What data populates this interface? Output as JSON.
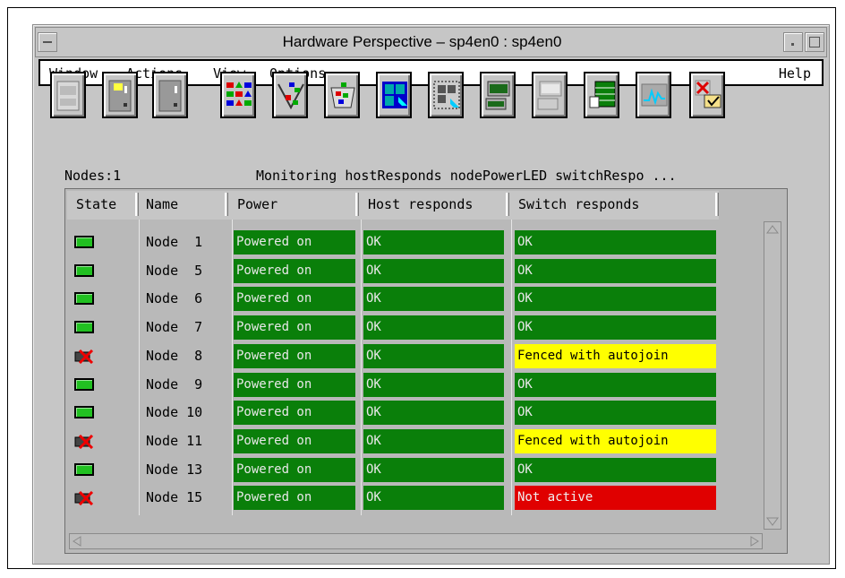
{
  "window": {
    "title": "Hardware Perspective – sp4en0 : sp4en0"
  },
  "menubar": {
    "items": [
      "Window",
      "Actions",
      "View",
      "Options"
    ],
    "help": "Help"
  },
  "toolbar": {
    "icons": [
      "frame-icon",
      "node-light-icon",
      "node-switch-icon",
      "node-group-icon",
      "filter-icon",
      "collection-icon",
      "layout-grid-icon",
      "select-grid-icon",
      "open-panel-icon",
      "closed-panel-icon",
      "table-view-icon",
      "monitor-icon",
      "delete-icon"
    ]
  },
  "status": {
    "nodes": "Nodes:1",
    "monitoring": "Monitoring hostResponds nodePowerLED switchRespo ..."
  },
  "table": {
    "columns": [
      "State",
      "Name",
      "Power",
      "Host responds",
      "Switch responds"
    ],
    "rows": [
      {
        "state": "ok",
        "name": "Node  1",
        "power": "Powered on",
        "host": "OK",
        "switch": "OK",
        "switch_status": "green"
      },
      {
        "state": "ok",
        "name": "Node  5",
        "power": "Powered on",
        "host": "OK",
        "switch": "OK",
        "switch_status": "green"
      },
      {
        "state": "ok",
        "name": "Node  6",
        "power": "Powered on",
        "host": "OK",
        "switch": "OK",
        "switch_status": "green"
      },
      {
        "state": "ok",
        "name": "Node  7",
        "power": "Powered on",
        "host": "OK",
        "switch": "OK",
        "switch_status": "green"
      },
      {
        "state": "error",
        "name": "Node  8",
        "power": "Powered on",
        "host": "OK",
        "switch": "Fenced with autojoin",
        "switch_status": "yellow"
      },
      {
        "state": "ok",
        "name": "Node  9",
        "power": "Powered on",
        "host": "OK",
        "switch": "OK",
        "switch_status": "green"
      },
      {
        "state": "ok",
        "name": "Node 10",
        "power": "Powered on",
        "host": "OK",
        "switch": "OK",
        "switch_status": "green"
      },
      {
        "state": "error",
        "name": "Node 11",
        "power": "Powered on",
        "host": "OK",
        "switch": "Fenced with autojoin",
        "switch_status": "yellow"
      },
      {
        "state": "ok",
        "name": "Node 13",
        "power": "Powered on",
        "host": "OK",
        "switch": "OK",
        "switch_status": "green"
      },
      {
        "state": "error",
        "name": "Node 15",
        "power": "Powered on",
        "host": "OK",
        "switch": "Not active",
        "switch_status": "red"
      }
    ]
  },
  "colors": {
    "ok": "#0a7f0a",
    "warning": "#ffff00",
    "error": "#e00000",
    "led_on": "#21c021"
  }
}
